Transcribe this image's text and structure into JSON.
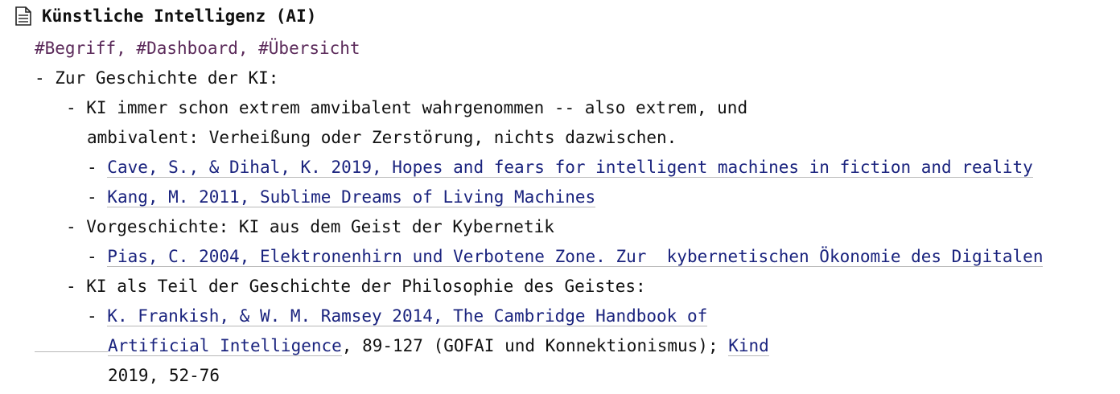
{
  "page": {
    "title": "Künstliche Intelligenz (AI)",
    "icon": "document-icon"
  },
  "tags": "#Begriff, #Dashboard, #Übersicht",
  "outline": {
    "l1_history": "- Zur Geschichte der KI:",
    "l2_ambivalence_a": "- KI immer schon extrem amvibalent wahrgenommen -- also extrem, und",
    "l2_ambivalence_b": "ambivalent: Verheißung oder Zerstörung, nichts dazwischen.",
    "bullet": "- ",
    "ref_cave": "Cave, S., & Dihal, K. 2019, Hopes and fears for intelligent machines in fiction and reality",
    "ref_kang": "Kang, M. 2011, Sublime Dreams of Living Machines",
    "l2_prehistory": "- Vorgeschichte: KI aus dem Geist der Kybernetik",
    "ref_pias": "Pias, C. 2004, Elektronenhirn und Verbotene Zone. Zur  kybernetischen Ökonomie des Digitalen",
    "l2_philosophy": "- KI als Teil der Geschichte der Philosophie des Geistes:",
    "ref_frankish_a": "K. Frankish, & W. M. Ramsey 2014, The Cambridge Handbook of",
    "ref_frankish_b": "Artificial Intelligence",
    "pages_text": ", 89-127 (GOFAI und Konnektionismus); ",
    "ref_kind": "Kind",
    "kind_rest": "2019, 52-76"
  },
  "colors": {
    "tag": "#5b2a5a",
    "link": "#1a237e",
    "text": "#111111"
  }
}
